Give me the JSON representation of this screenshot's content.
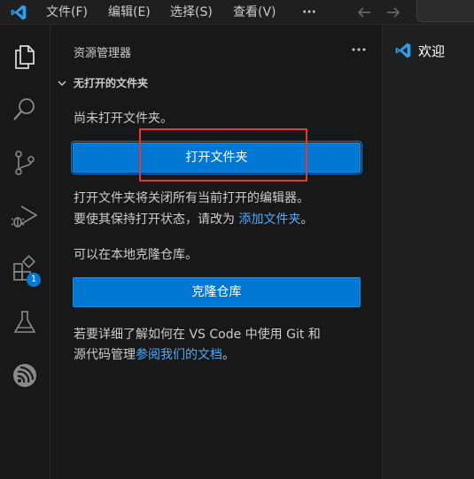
{
  "titlebar": {
    "menus": [
      "文件(F)",
      "编辑(E)",
      "选择(S)",
      "查看(V)"
    ],
    "more_label": "···"
  },
  "activitybar": {
    "icons": [
      "explorer-icon",
      "search-icon",
      "source-control-icon",
      "run-debug-icon",
      "extensions-icon",
      "testing-icon",
      "remote-icon"
    ],
    "extensions_badge": "1"
  },
  "sidebar": {
    "title": "资源管理器",
    "more_label": "···",
    "section_title": "无打开的文件夹",
    "no_folder_text": "尚未打开文件夹。",
    "open_folder_button": "打开文件夹",
    "note_line1": "打开文件夹将关闭所有当前打开的编辑器。",
    "note_line2_prefix": "要使其保持打开状态，请改为 ",
    "note_line2_link": "添加文件夹",
    "note_line2_suffix": "。",
    "clone_text": "可以在本地克隆仓库。",
    "clone_button": "克隆仓库",
    "git_line1": "若要详细了解如何在 VS Code 中使用 Git 和",
    "git_line2_prefix": "源代码管理",
    "git_line2_link": "参阅我们的文档",
    "git_line2_suffix": "。"
  },
  "editor": {
    "tab_label": "欢迎"
  },
  "colors": {
    "accent": "#0078d4",
    "link": "#4daafc",
    "highlight_box": "#e8372f",
    "vscode_blue": "#2aa1f0"
  }
}
